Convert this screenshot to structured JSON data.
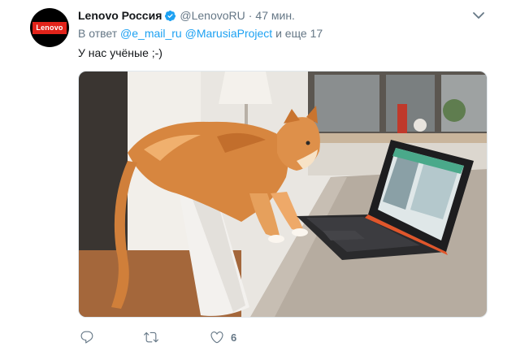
{
  "tweet": {
    "author": {
      "display_name": "Lenovo Россия",
      "handle": "@LenovoRU",
      "avatar_text": "Lenovo",
      "verified": true
    },
    "separator": "·",
    "time": "47 мин.",
    "reply_context": {
      "prefix": "В ответ",
      "mentions": [
        "@e_mail_ru",
        "@MarusiaProject"
      ],
      "suffix": "и еще 17"
    },
    "text": "У нас учёные ;-)",
    "image": {
      "subject": "ginger-cat-looking-at-laptop"
    },
    "actions": {
      "reply": {
        "icon": "reply-icon",
        "count": ""
      },
      "retweet": {
        "icon": "retweet-icon",
        "count": ""
      },
      "like": {
        "icon": "heart-icon",
        "count": "6"
      }
    }
  },
  "colors": {
    "accent": "#1da1f2",
    "secondary_text": "#657786",
    "primary_text": "#14171a",
    "avatar_bg": "#000000",
    "brand_red": "#e2231a"
  }
}
